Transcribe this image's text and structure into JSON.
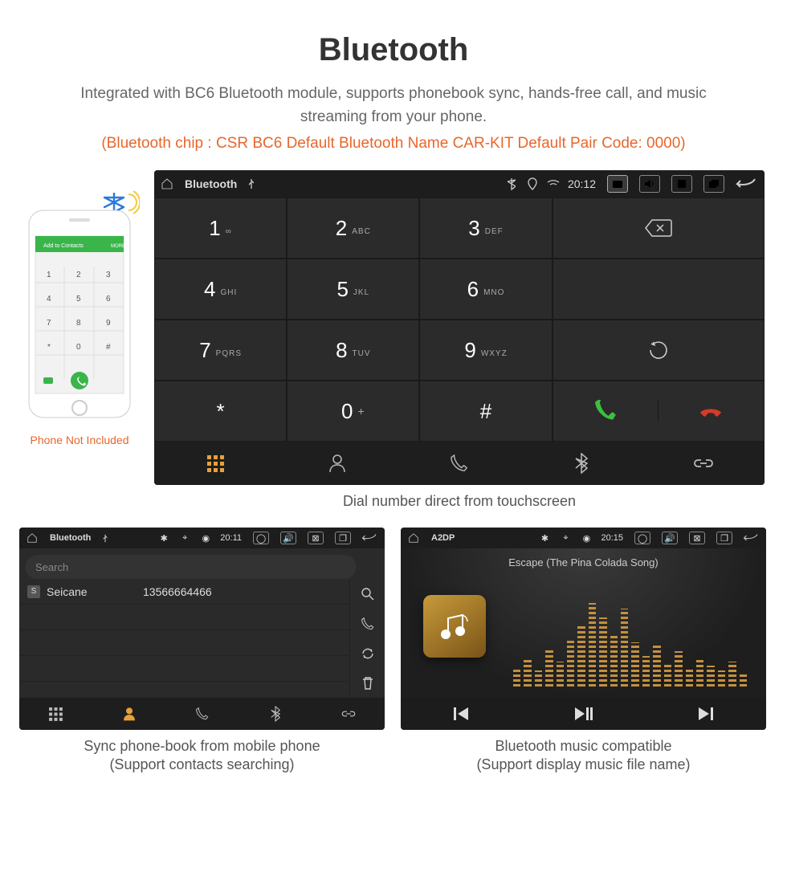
{
  "hero": {
    "title": "Bluetooth",
    "desc": "Integrated with BC6 Bluetooth module, supports phonebook sync, hands-free call, and music streaming from your phone.",
    "spec": "(Bluetooth chip : CSR BC6     Default Bluetooth Name CAR-KIT     Default Pair Code: 0000)"
  },
  "phone": {
    "note": "Phone Not Included",
    "screen_label": "Add to Contacts",
    "more": "MORE"
  },
  "dialer": {
    "statusbar": {
      "title": "Bluetooth",
      "time": "20:12"
    },
    "keys": [
      {
        "num": "1",
        "sub": "∞"
      },
      {
        "num": "2",
        "sub": "ABC"
      },
      {
        "num": "3",
        "sub": "DEF"
      },
      {
        "num": "4",
        "sub": "GHI"
      },
      {
        "num": "5",
        "sub": "JKL"
      },
      {
        "num": "6",
        "sub": "MNO"
      },
      {
        "num": "7",
        "sub": "PQRS"
      },
      {
        "num": "8",
        "sub": "TUV"
      },
      {
        "num": "9",
        "sub": "WXYZ"
      },
      {
        "num": "*",
        "sub": ""
      },
      {
        "num": "0",
        "sub": "+"
      },
      {
        "num": "#",
        "sub": ""
      }
    ],
    "caption": "Dial number direct from touchscreen"
  },
  "contacts": {
    "statusbar": {
      "title": "Bluetooth",
      "time": "20:11"
    },
    "search_placeholder": "Search",
    "rows": [
      {
        "badge": "S",
        "name": "Seicane",
        "number": "13566664466"
      }
    ],
    "caption1": "Sync phone-book from mobile phone",
    "caption2": "(Support contacts searching)"
  },
  "music": {
    "statusbar": {
      "title": "A2DP",
      "time": "20:15"
    },
    "track": "Escape (The Pina Colada Song)",
    "caption1": "Bluetooth music compatible",
    "caption2": "(Support display music file name)"
  }
}
